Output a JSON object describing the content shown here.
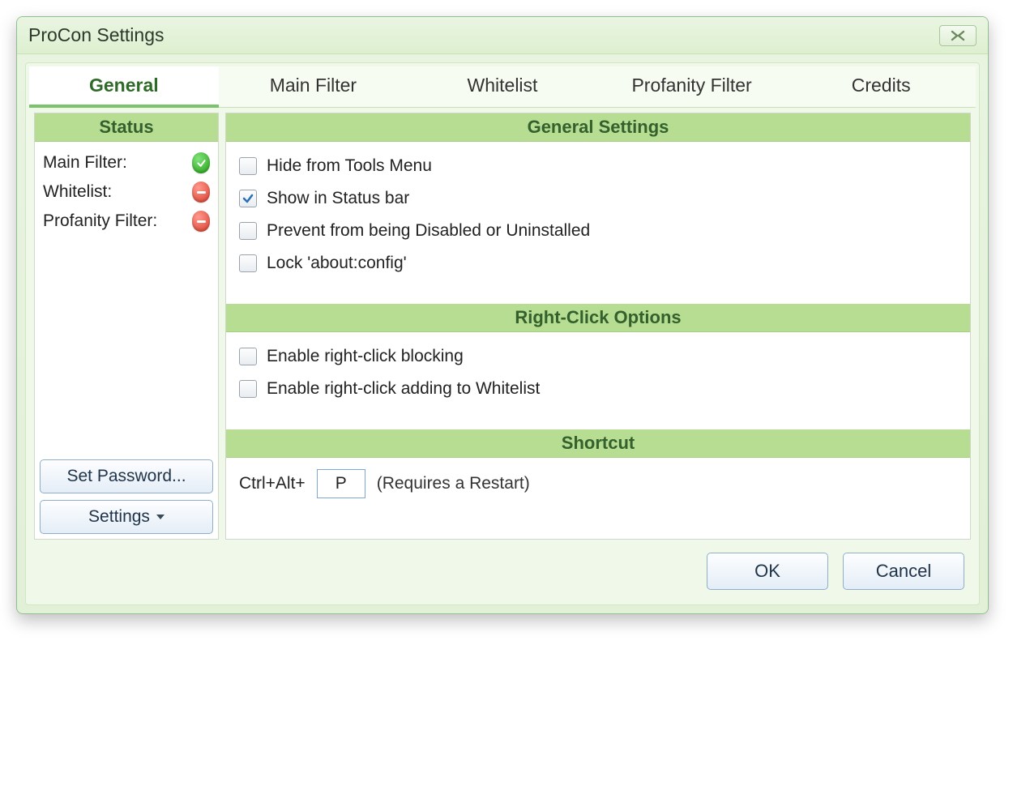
{
  "window": {
    "title": "ProCon Settings"
  },
  "tabs": [
    {
      "label": "General",
      "active": true
    },
    {
      "label": "Main Filter",
      "active": false
    },
    {
      "label": "Whitelist",
      "active": false
    },
    {
      "label": "Profanity Filter",
      "active": false
    },
    {
      "label": "Credits",
      "active": false
    }
  ],
  "sidebar": {
    "header": "Status",
    "items": [
      {
        "label": "Main Filter:",
        "status": "ok"
      },
      {
        "label": "Whitelist:",
        "status": "off"
      },
      {
        "label": "Profanity Filter:",
        "status": "off"
      }
    ],
    "set_password_label": "Set Password...",
    "settings_label": "Settings"
  },
  "sections": {
    "general": {
      "header": "General Settings",
      "options": [
        {
          "label": "Hide from Tools Menu",
          "checked": false
        },
        {
          "label": "Show in Status bar",
          "checked": true
        },
        {
          "label": "Prevent from being Disabled or Uninstalled",
          "checked": false
        },
        {
          "label": "Lock 'about:config'",
          "checked": false
        }
      ]
    },
    "rightclick": {
      "header": "Right-Click Options",
      "options": [
        {
          "label": "Enable right-click blocking",
          "checked": false
        },
        {
          "label": "Enable right-click adding to Whitelist",
          "checked": false
        }
      ]
    },
    "shortcut": {
      "header": "Shortcut",
      "prefix": "Ctrl+Alt+",
      "key": "P",
      "hint": "(Requires a Restart)"
    }
  },
  "footer": {
    "ok": "OK",
    "cancel": "Cancel"
  }
}
